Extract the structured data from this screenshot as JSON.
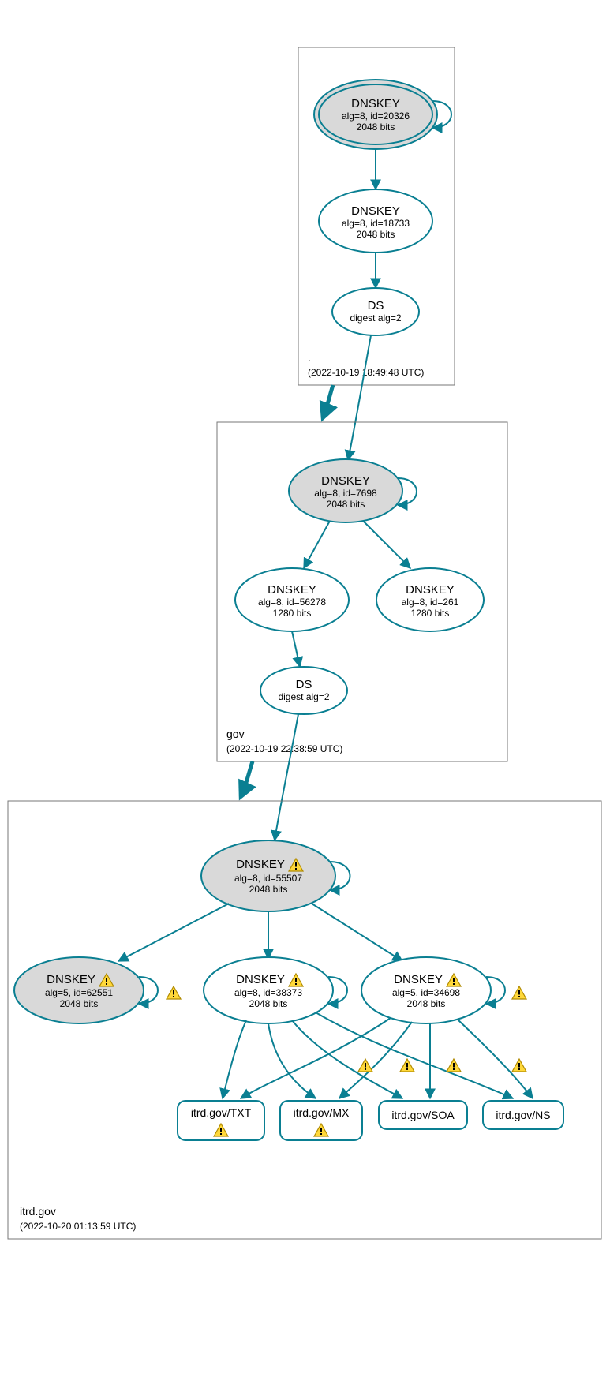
{
  "colors": {
    "teal": "#0a7f92",
    "grey_fill": "#d9d9d9",
    "warn_fill": "#ffd83a",
    "warn_stroke": "#b08a00"
  },
  "zones": {
    "root": {
      "name": ".",
      "timestamp": "(2022-10-19 18:49:48 UTC)"
    },
    "gov": {
      "name": "gov",
      "timestamp": "(2022-10-19 22:38:59 UTC)"
    },
    "itrd": {
      "name": "itrd.gov",
      "timestamp": "(2022-10-20 01:13:59 UTC)"
    }
  },
  "nodes": {
    "root_ksk": {
      "title": "DNSKEY",
      "line1": "alg=8, id=20326",
      "line2": "2048 bits"
    },
    "root_zsk": {
      "title": "DNSKEY",
      "line1": "alg=8, id=18733",
      "line2": "2048 bits"
    },
    "root_ds": {
      "title": "DS",
      "line1": "digest alg=2"
    },
    "gov_ksk": {
      "title": "DNSKEY",
      "line1": "alg=8, id=7698",
      "line2": "2048 bits"
    },
    "gov_zsk1": {
      "title": "DNSKEY",
      "line1": "alg=8, id=56278",
      "line2": "1280 bits"
    },
    "gov_zsk2": {
      "title": "DNSKEY",
      "line1": "alg=8, id=261",
      "line2": "1280 bits"
    },
    "gov_ds": {
      "title": "DS",
      "line1": "digest alg=2"
    },
    "itrd_ksk": {
      "title": "DNSKEY",
      "line1": "alg=8, id=55507",
      "line2": "2048 bits",
      "warn": true
    },
    "itrd_k1": {
      "title": "DNSKEY",
      "line1": "alg=5, id=62551",
      "line2": "2048 bits",
      "warn": true
    },
    "itrd_k2": {
      "title": "DNSKEY",
      "line1": "alg=8, id=38373",
      "line2": "2048 bits",
      "warn": true
    },
    "itrd_k3": {
      "title": "DNSKEY",
      "line1": "alg=5, id=34698",
      "line2": "2048 bits",
      "warn": true
    }
  },
  "leaves": {
    "txt": {
      "label": "itrd.gov/TXT",
      "warn": true
    },
    "mx": {
      "label": "itrd.gov/MX",
      "warn": true
    },
    "soa": {
      "label": "itrd.gov/SOA"
    },
    "ns": {
      "label": "itrd.gov/NS"
    }
  }
}
